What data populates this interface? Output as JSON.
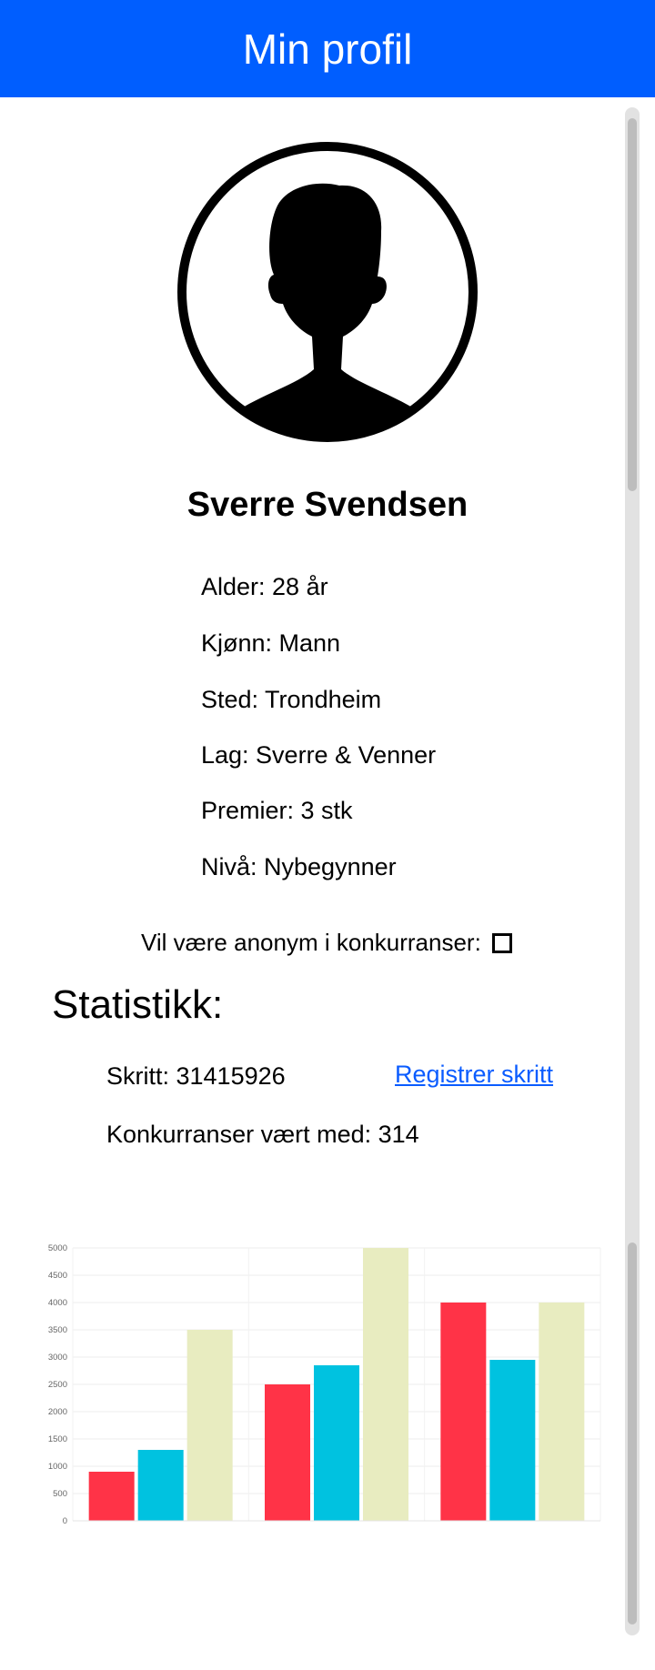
{
  "header": {
    "title": "Min profil"
  },
  "profile": {
    "name": "Sverre Svendsen",
    "avatar_icon": "person-silhouette-icon",
    "details": [
      "Alder: 28 år",
      "Kjønn: Mann",
      "Sted: Trondheim",
      "Lag: Sverre & Venner",
      "Premier: 3 stk",
      "Nivå: Nybegynner"
    ],
    "anonymous_label": "Vil være anonym i konkurranser:",
    "anonymous_checked": false
  },
  "stats": {
    "heading": "Statistikk:",
    "steps": "Skritt: 31415926",
    "register_link": "Registrer skritt",
    "competitions": "Konkurranser vært med: 314"
  },
  "colors": {
    "header_bg": "#005eff",
    "link": "#0a5cff",
    "series": [
      "#ff3347",
      "#00c2e0",
      "#e8ecc0"
    ]
  },
  "chart_data": {
    "type": "bar",
    "categories": [
      "",
      "",
      ""
    ],
    "series": [
      {
        "values": [
          900,
          2500,
          4000
        ]
      },
      {
        "values": [
          1300,
          2850,
          2950
        ]
      },
      {
        "values": [
          3500,
          5000,
          4000
        ]
      }
    ],
    "ylim": [
      0,
      5000
    ],
    "yticks": [
      0,
      500,
      1000,
      1500,
      2000,
      2500,
      3000,
      3500,
      4000,
      4500,
      5000
    ],
    "grid": true,
    "legend": "none"
  }
}
